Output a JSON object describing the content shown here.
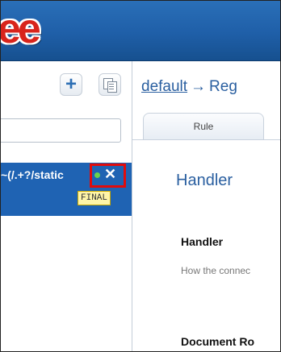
{
  "header": {
    "logo_text": "ee"
  },
  "left_panel": {
    "filter": {
      "value": "",
      "placeholder": ""
    },
    "rules": [
      {
        "label": "~(/.+?/static",
        "badge": "FINAL"
      }
    ]
  },
  "right_panel": {
    "breadcrumb": {
      "link": "default",
      "arrow": "→",
      "current": "Reg"
    },
    "tabs": [
      {
        "label": "Rule"
      }
    ],
    "section_title": "Handler",
    "fields": [
      {
        "label": "Handler",
        "description": "How the connec"
      },
      {
        "label": "Document Ro",
        "description": ""
      }
    ]
  },
  "colors": {
    "header": "#1f5fa8",
    "selected_row": "#1f63b3",
    "link": "#2a5fa0",
    "highlight": "#e20b0b",
    "badge": "#fff5a8"
  },
  "icons": [
    "add-icon",
    "copy-icon",
    "status-dot-icon",
    "close-icon"
  ]
}
